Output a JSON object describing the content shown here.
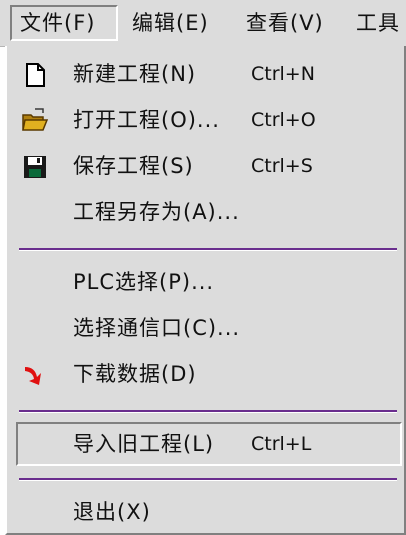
{
  "menubar": {
    "items": [
      {
        "label": "文件(F)"
      },
      {
        "label": "编辑(E)"
      },
      {
        "label": "查看(V)"
      },
      {
        "label": "工具"
      }
    ]
  },
  "file_menu": {
    "items": [
      {
        "label": "新建工程(N)",
        "shortcut": "Ctrl+N",
        "icon": "new-file-icon"
      },
      {
        "label": "打开工程(O)...",
        "shortcut": "Ctrl+O",
        "icon": "open-folder-icon"
      },
      {
        "label": "保存工程(S)",
        "shortcut": "Ctrl+S",
        "icon": "save-disk-icon"
      },
      {
        "label": "工程另存为(A)..."
      },
      {
        "label": "PLC选择(P)..."
      },
      {
        "label": "选择通信口(C)..."
      },
      {
        "label": "下载数据(D)",
        "icon": "download-arrow-icon"
      },
      {
        "label": "导入旧工程(L)",
        "shortcut": "Ctrl+L"
      },
      {
        "label": "退出(X)"
      }
    ]
  },
  "colors": {
    "menu_bg": "#dcdcdc",
    "separator": "#6a2e8e",
    "download_arrow": "#e01010",
    "open_folder": "#e0b020"
  }
}
